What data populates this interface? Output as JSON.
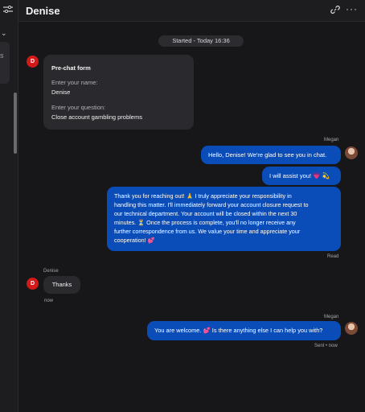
{
  "header": {
    "title": "Denise"
  },
  "sidebar": {
    "partial_text": "s"
  },
  "chat": {
    "started_label": "Started - Today 16:36",
    "prechat": {
      "title": "Pre-chat form",
      "name_label": "Enter your name:",
      "name_value": "Denise",
      "question_label": "Enter your question:",
      "question_value": "Close account gambling problems",
      "avatar_letter": "D"
    },
    "agent_name": "Megan",
    "msg1": "Hello, Denise! We're glad to see you in chat.",
    "msg2_text": "I will assist you!",
    "msg2_emoji": "💗 💫",
    "msg3_lines": [
      "Thank you for reaching out! 🙏 I truly appreciate your responsibility in",
      "handling this matter. I'll immediately forward your account closure request to",
      "our technical department. Your account will be closed within the next 30",
      "minutes. ⏳ Once the process is complete, you'll no longer receive any",
      "further correspondence from us. We value your time and appreciate your",
      "cooperation! 💕"
    ],
    "status_read": "Read",
    "visitor_name": "Denise",
    "visitor_msg": "Thanks",
    "visitor_time": "now",
    "agent_name_2": "Megan",
    "msg4": "You are welcome. 💕 Is there anything else I can help you with?",
    "msg4_status": "Sent • now",
    "colors": {
      "accent": "#0b4db8",
      "avatar_red": "#d11a1a",
      "background": "#171719"
    }
  },
  "icons": [
    "filter-icon",
    "chevron-down-icon",
    "link-icon",
    "more-icon"
  ]
}
